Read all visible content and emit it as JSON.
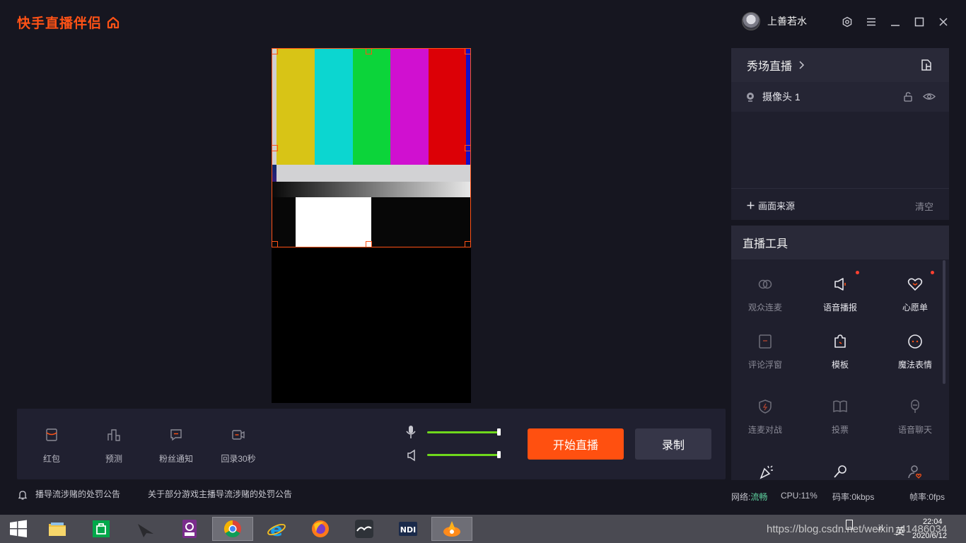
{
  "app": {
    "brand": "快手直播伴侣",
    "user_name": "上善若水"
  },
  "preview": {
    "bar_colors": [
      "#d8c416",
      "#0cd6d0",
      "#0cd43a",
      "#d010d0",
      "#dc0006"
    ]
  },
  "bottom_tools": [
    {
      "label": "红包",
      "icon": "red-packet-icon"
    },
    {
      "label": "预测",
      "icon": "prediction-icon"
    },
    {
      "label": "粉丝通知",
      "icon": "fan-notice-icon"
    },
    {
      "label": "回录30秒",
      "icon": "replay-record-icon"
    }
  ],
  "audio": {
    "mic_level": 1.0,
    "speaker_level": 1.0
  },
  "actions": {
    "start_label": "开始直播",
    "record_label": "录制"
  },
  "notices": {
    "first": "播导流涉赌的处罚公告",
    "second": "关于部分游戏主播导流涉赌的处罚公告"
  },
  "sources": {
    "title": "秀场直播",
    "items": [
      {
        "label": "摄像头 1"
      }
    ],
    "add_label": "画面来源",
    "clear_label": "清空"
  },
  "tools": {
    "title": "直播工具",
    "items": [
      {
        "label": "观众连麦",
        "icon": "audience-link-icon",
        "dot": false,
        "enabled": false
      },
      {
        "label": "语音播报",
        "icon": "speaker-announce-icon",
        "dot": true,
        "enabled": true
      },
      {
        "label": "心愿单",
        "icon": "wishlist-heart-icon",
        "dot": true,
        "enabled": true
      },
      {
        "label": "评论浮窗",
        "icon": "comment-window-icon",
        "dot": false,
        "enabled": false
      },
      {
        "label": "模板",
        "icon": "template-puzzle-icon",
        "dot": false,
        "enabled": true
      },
      {
        "label": "魔法表情",
        "icon": "magic-face-icon",
        "dot": false,
        "enabled": true
      },
      {
        "label": "连麦对战",
        "icon": "pk-shield-icon",
        "dot": false,
        "enabled": false
      },
      {
        "label": "投票",
        "icon": "vote-book-icon",
        "dot": false,
        "enabled": false
      },
      {
        "label": "语音聊天",
        "icon": "voice-chat-icon",
        "dot": false,
        "enabled": false
      }
    ]
  },
  "status": {
    "network_label": "网络:",
    "network_value": "流畅",
    "cpu": "CPU:11%",
    "bitrate": "码率:0kbps",
    "fps": "帧率:0fps"
  },
  "taskbar": {
    "time": "22:04",
    "date": "2020/6/12",
    "ime": "英",
    "watermark": "https://blog.csdn.net/weixin_41486034"
  },
  "colors": {
    "accent": "#ff5216",
    "network_ok": "#5fd4a0",
    "slider": "#6fd81c"
  }
}
